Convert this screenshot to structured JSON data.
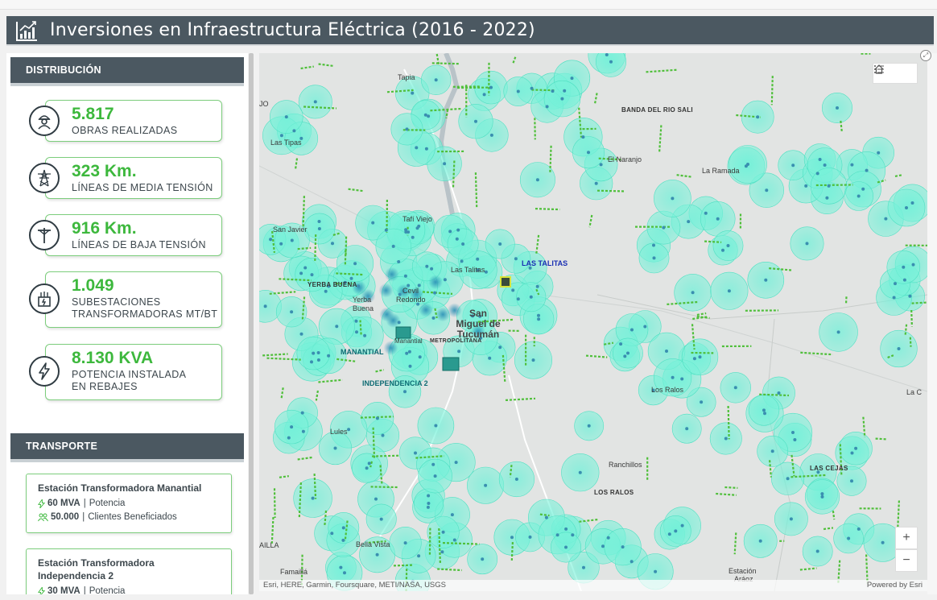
{
  "header": {
    "title": "Inversiones en Infraestructura Eléctrica (2016 - 2022)",
    "icon": "bar-chart-icon"
  },
  "distribucion": {
    "heading": "DISTRIBUCIÓN",
    "kpis": [
      {
        "value": "5.817",
        "label1": "OBRAS REALIZADAS",
        "label2": "",
        "icon": "worker-icon"
      },
      {
        "value": "323 Km.",
        "label1": "LÍNEAS DE MEDIA TENSIÓN",
        "label2": "",
        "icon": "transmission-tower-icon"
      },
      {
        "value": "916 Km.",
        "label1": "LÍNEAS DE BAJA TENSIÓN",
        "label2": "",
        "icon": "utility-pole-icon"
      },
      {
        "value": "1.049",
        "label1": "SUBESTACIONES",
        "label2": "TRANSFORMADORAS MT/BT",
        "icon": "substation-icon"
      },
      {
        "value": "8.130 KVA",
        "label1": "POTENCIA INSTALADA",
        "label2": "EN REBAJES",
        "icon": "lightning-icon"
      }
    ]
  },
  "transporte": {
    "heading": "TRANSPORTE",
    "stations": [
      {
        "title1": "Estación Transformadora Manantial",
        "title2": "",
        "power_value": "60 MVA",
        "power_label": "Potencia",
        "clients_value": "50.000",
        "clients_label": "Clientes Beneficiados"
      },
      {
        "title1": "Estación Transformadora",
        "title2": "Independencia 2",
        "power_value": "30 MVA",
        "power_label": "Potencia"
      }
    ]
  },
  "map": {
    "attribution": "Esri, HERE, Garmin, Foursquare, METI/NASA, USGS",
    "powered_by": "Powered by Esri",
    "zoom_in": "+",
    "zoom_out": "−",
    "places": {
      "tapia": "Tapia",
      "jo": "JO",
      "banda": "BANDA DEL RIO SALI",
      "las_tipas": "Las Tipas",
      "el_naranjo": "El Naranjo",
      "la_ramada": "La Ramada",
      "tafi_viejo": "Tafí Viejo",
      "san_javier": "San Javier",
      "las_talitas_blue": "LAS TALITAS",
      "las_talitas": "Las Talitas",
      "yerba_buena_cap": "YERBA BUENA",
      "yerba": "Yerba",
      "buena": "Buena",
      "cevil": "Cevil",
      "redondo": "Redondo",
      "san": "San",
      "miguel_de": "Miguel de",
      "tucuman": "Tucumán",
      "manantial_small": "Manantial",
      "metropolitana": "METROPOLITANA",
      "manantial": "MANANTIAL",
      "independencia": "INDEPENDENCIA 2",
      "los_ralos": "Los Ralos",
      "la_c": "La C",
      "lules": "Lules",
      "ranchillos": "Ranchillos",
      "las_cejas": "LAS CEJAS",
      "los_ralos_cap": "LOS RALOS",
      "ailla": "AILLA",
      "bella_vista": "Bella Vista",
      "estacion": "Estación",
      "araoz": "Aráoz",
      "famailla": "Famaillá"
    }
  }
}
